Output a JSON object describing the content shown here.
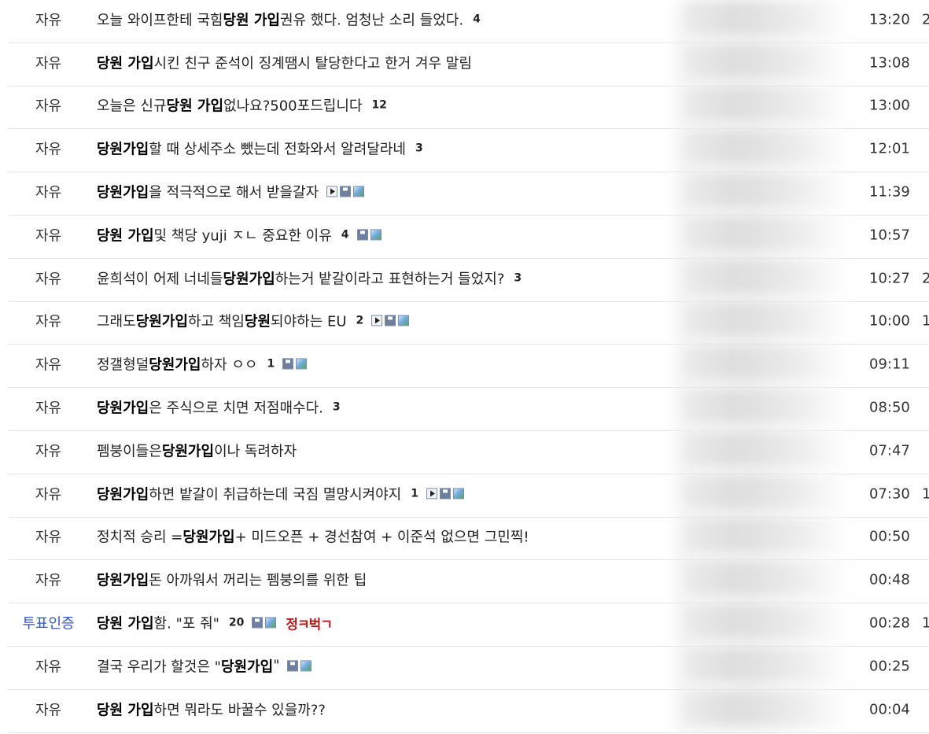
{
  "posts": [
    {
      "category": "자유",
      "title": [
        {
          "t": "오늘 와이프한테 국힘 ",
          "b": false
        },
        {
          "t": "당원 가입",
          "b": true
        },
        {
          "t": " 권유 했다. 엄청난 소리 들었다.",
          "b": false
        }
      ],
      "comments": "4",
      "icons": [],
      "time": "13:20",
      "extra": "2"
    },
    {
      "category": "자유",
      "title": [
        {
          "t": "당원 가입",
          "b": true
        },
        {
          "t": "시킨 친구 준석이 징계땜시 탈당한다고 한거 겨우 말림",
          "b": false
        }
      ],
      "comments": "",
      "icons": [],
      "time": "13:08",
      "extra": ""
    },
    {
      "category": "자유",
      "title": [
        {
          "t": "오늘은 신규",
          "b": false
        },
        {
          "t": "당원 가입",
          "b": true
        },
        {
          "t": " 없나요?500포드립니다",
          "b": false
        }
      ],
      "comments": "12",
      "icons": [],
      "time": "13:00",
      "extra": ""
    },
    {
      "category": "자유",
      "title": [
        {
          "t": "당원가입",
          "b": true
        },
        {
          "t": "할 때 상세주소 뺐는데 전화와서 알려달라네",
          "b": false
        }
      ],
      "comments": "3",
      "icons": [],
      "time": "12:01",
      "extra": ""
    },
    {
      "category": "자유",
      "title": [
        {
          "t": "당원가입",
          "b": true
        },
        {
          "t": "을 적극적으로 해서 받을갈자",
          "b": false
        }
      ],
      "comments": "",
      "icons": [
        "play-icon",
        "disk-icon",
        "image-icon"
      ],
      "time": "11:39",
      "extra": ""
    },
    {
      "category": "자유",
      "title": [
        {
          "t": "당원 가입",
          "b": true
        },
        {
          "t": " 및 책당 yuji ㅈㄴ 중요한 이유",
          "b": false
        }
      ],
      "comments": "4",
      "icons": [
        "disk-icon",
        "image-icon"
      ],
      "time": "10:57",
      "extra": ""
    },
    {
      "category": "자유",
      "title": [
        {
          "t": "윤희석이 어제 너네들 ",
          "b": false
        },
        {
          "t": "당원가입",
          "b": true
        },
        {
          "t": "하는거 밭갈이라고 표현하는거 들었지?",
          "b": false
        }
      ],
      "comments": "3",
      "icons": [],
      "time": "10:27",
      "extra": "2"
    },
    {
      "category": "자유",
      "title": [
        {
          "t": "그래도 ",
          "b": false
        },
        {
          "t": "당원가입",
          "b": true
        },
        {
          "t": "하고 책임",
          "b": false
        },
        {
          "t": "당원",
          "b": true
        },
        {
          "t": " 되야하는 EU",
          "b": false
        }
      ],
      "comments": "2",
      "icons": [
        "play-icon",
        "disk-icon",
        "image-icon"
      ],
      "time": "10:00",
      "extra": "1"
    },
    {
      "category": "자유",
      "title": [
        {
          "t": "정갤형덜 ",
          "b": false
        },
        {
          "t": "당원가입",
          "b": true
        },
        {
          "t": "하자 ㅇㅇ",
          "b": false
        }
      ],
      "comments": "1",
      "icons": [
        "disk-icon",
        "image-icon"
      ],
      "time": "09:11",
      "extra": ""
    },
    {
      "category": "자유",
      "title": [
        {
          "t": "당원가입",
          "b": true
        },
        {
          "t": "은 주식으로 치면 저점매수다.",
          "b": false
        }
      ],
      "comments": "3",
      "icons": [],
      "time": "08:50",
      "extra": ""
    },
    {
      "category": "자유",
      "title": [
        {
          "t": "펨붕이들은 ",
          "b": false
        },
        {
          "t": "당원가입",
          "b": true
        },
        {
          "t": "이나 독려하자",
          "b": false
        }
      ],
      "comments": "",
      "icons": [],
      "time": "07:47",
      "extra": ""
    },
    {
      "category": "자유",
      "title": [
        {
          "t": "당원가입",
          "b": true
        },
        {
          "t": "하면 밭갈이 취급하는데 국짐 멸망시켜야지",
          "b": false
        }
      ],
      "comments": "1",
      "icons": [
        "play-icon",
        "disk-icon",
        "image-icon"
      ],
      "time": "07:30",
      "extra": "1"
    },
    {
      "category": "자유",
      "title": [
        {
          "t": "정치적 승리 = ",
          "b": false
        },
        {
          "t": "당원가입",
          "b": true
        },
        {
          "t": " + 미드오픈 + 경선참여 + 이준석 없으면 그민찍!",
          "b": false
        }
      ],
      "comments": "",
      "icons": [],
      "time": "00:50",
      "extra": ""
    },
    {
      "category": "자유",
      "title": [
        {
          "t": "당원가입",
          "b": true
        },
        {
          "t": " 돈 아까워서 꺼리는 펨붕의를 위한 팁",
          "b": false
        }
      ],
      "comments": "",
      "icons": [],
      "time": "00:48",
      "extra": ""
    },
    {
      "category": "투표인증",
      "title": [
        {
          "t": "당원 가입",
          "b": true
        },
        {
          "t": "함. \"포 줘\"",
          "b": false
        }
      ],
      "comments": "20",
      "icons": [
        "disk-icon",
        "image-icon"
      ],
      "badge": "정ㅋ벅ㄱ",
      "time": "00:28",
      "extra": "1"
    },
    {
      "category": "자유",
      "title": [
        {
          "t": "결국 우리가 할것은 \"",
          "b": false
        },
        {
          "t": "당원가입",
          "b": true
        },
        {
          "t": "\"",
          "b": false
        }
      ],
      "comments": "",
      "icons": [
        "disk-icon",
        "image-icon"
      ],
      "time": "00:25",
      "extra": ""
    },
    {
      "category": "자유",
      "title": [
        {
          "t": "당원 가입",
          "b": true
        },
        {
          "t": "하면 뭐라도 바꿀수 있을까??",
          "b": false
        }
      ],
      "comments": "",
      "icons": [],
      "time": "00:04",
      "extra": ""
    }
  ],
  "colors": {
    "vote_category": "#3355cc",
    "badge": "#b81c1c",
    "divider": "#e6e6e6"
  }
}
